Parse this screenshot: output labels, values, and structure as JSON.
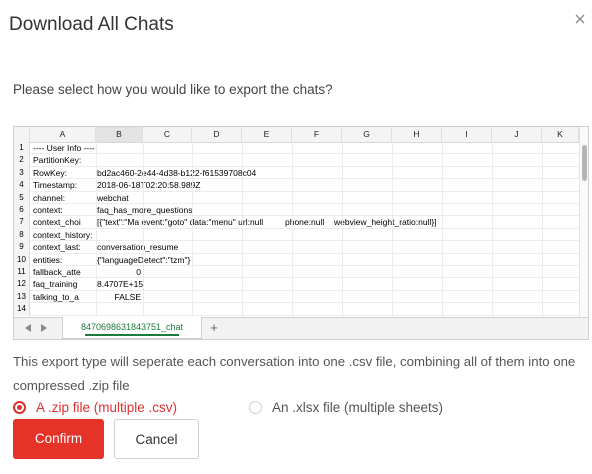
{
  "dialog": {
    "title": "Download All Chats",
    "prompt": "Please select how you would like to export the chats?",
    "description": "This export type will seperate each conversation into one .csv file, combining all of them into one compressed .zip file"
  },
  "sheet": {
    "columns": [
      "A",
      "B",
      "C",
      "D",
      "E",
      "F",
      "G",
      "H",
      "I",
      "J",
      "K"
    ],
    "selected_column": "B",
    "rows": [
      {
        "n": "1",
        "a": "---- User Info ----",
        "b": "",
        "f": "",
        "g": ""
      },
      {
        "n": "2",
        "a": "PartitionKey:",
        "b": "",
        "f": "",
        "g": ""
      },
      {
        "n": "3",
        "a": "RowKey:",
        "b": "bd2ac460-2e44-4d38-b122-f61539708c04",
        "f": "",
        "g": ""
      },
      {
        "n": "4",
        "a": "Timestamp:",
        "b": "2018-06-18T02:20:58.989Z",
        "f": "",
        "g": ""
      },
      {
        "n": "5",
        "a": "channel:",
        "b": "webchat",
        "f": "",
        "g": ""
      },
      {
        "n": "6",
        "a": "context:",
        "b": "faq_has_more_questions",
        "f": "",
        "g": ""
      },
      {
        "n": "7",
        "a": "context_choi",
        "b": "[{\"text\":\"Ma event:\"goto\" data:\"menu\" url:null",
        "f": "phone:null",
        "g": "webview_height_ratio:null}]"
      },
      {
        "n": "8",
        "a": "context_history:",
        "b": "",
        "f": "",
        "g": ""
      },
      {
        "n": "9",
        "a": "context_last:",
        "b": "conversation_resume",
        "f": "",
        "g": ""
      },
      {
        "n": "10",
        "a": "entities:",
        "b": "{\"languageDetect\":\"tzm\"}",
        "f": "",
        "g": ""
      },
      {
        "n": "11",
        "a": "fallback_atte",
        "b": "0",
        "f": "",
        "g": ""
      },
      {
        "n": "12",
        "a": "faq_training",
        "b": "8.4707E+15",
        "f": "",
        "g": ""
      },
      {
        "n": "13",
        "a": "talking_to_a",
        "b": "FALSE",
        "f": "",
        "g": ""
      },
      {
        "n": "14",
        "a": "",
        "b": "",
        "f": "",
        "g": ""
      }
    ],
    "tab_name": "8470698631843751_chat",
    "add_sheet_label": "+"
  },
  "options": {
    "zip_label": "A .zip file (multiple .csv)",
    "xlsx_label": "An .xlsx file (multiple sheets)",
    "selected": "zip"
  },
  "buttons": {
    "confirm": "Confirm",
    "cancel": "Cancel"
  },
  "colors": {
    "accent": "#e5332a",
    "sheet_tab": "#1d7a3a"
  },
  "icons": {
    "close": "close-icon",
    "prev_sheet": "arrow-left-icon",
    "next_sheet": "arrow-right-icon"
  }
}
